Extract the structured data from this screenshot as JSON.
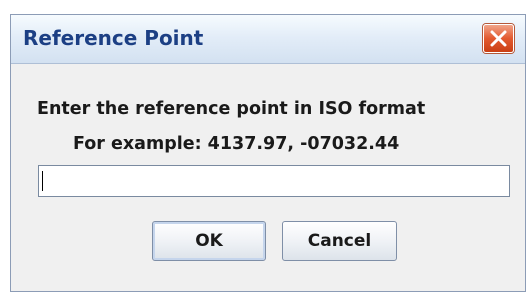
{
  "window": {
    "title": "Reference Point"
  },
  "dialog": {
    "message": "Enter the reference point in ISO format",
    "example": "For example: 4137.97, -07032.44",
    "input_value": "",
    "ok_label": "OK",
    "cancel_label": "Cancel"
  },
  "icons": {
    "close": "close-icon"
  },
  "colors": {
    "title_text": "#1c3f84",
    "close_button": "#e35a2f",
    "dialog_background": "#f0f0f0"
  }
}
